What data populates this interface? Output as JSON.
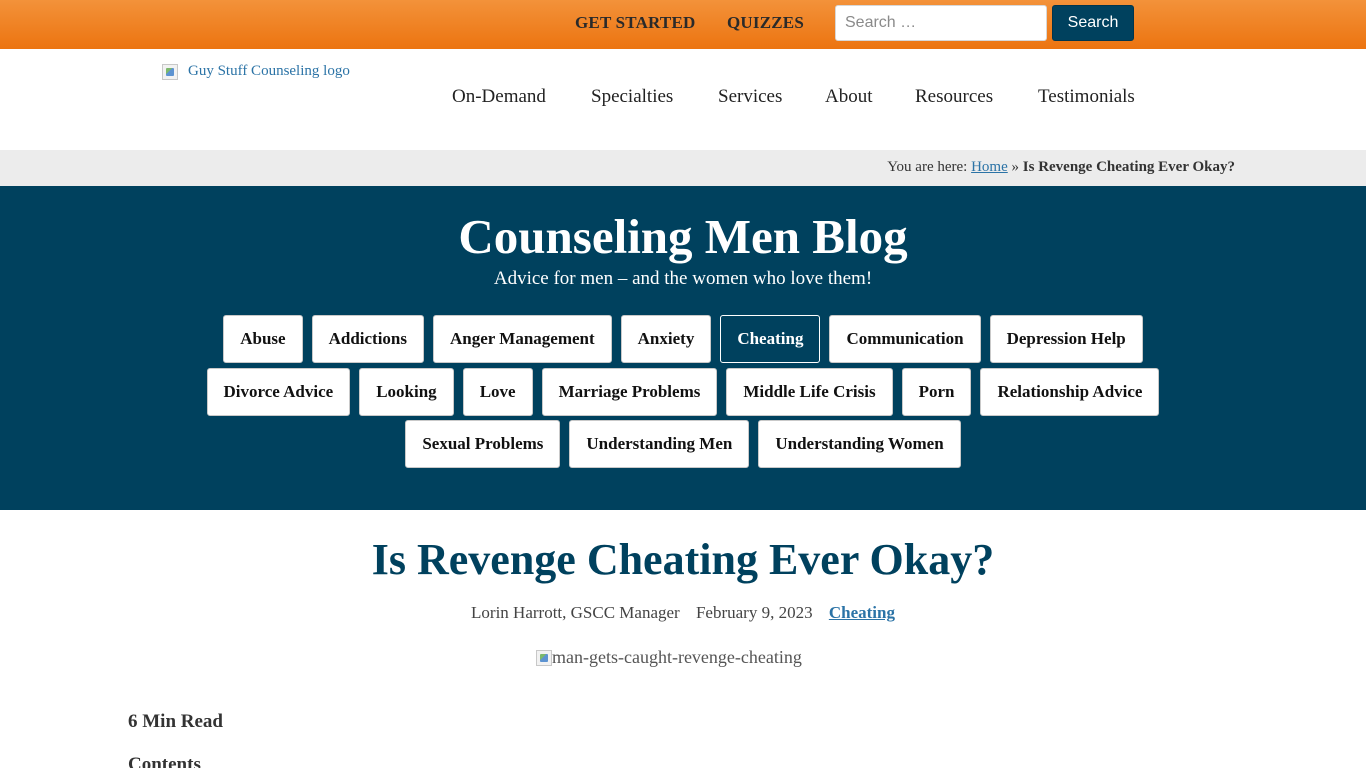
{
  "topbar": {
    "links": [
      "GET STARTED",
      "QUIZZES"
    ],
    "search": {
      "placeholder": "Search …",
      "value": "",
      "button_label": "Search"
    },
    "gradient_colors": [
      "#f3923a",
      "#ec7410"
    ]
  },
  "header": {
    "logo_alt": "Guy Stuff Counseling logo",
    "nav": [
      "On-Demand",
      "Specialties",
      "Services",
      "About",
      "Resources",
      "Testimonials"
    ]
  },
  "breadcrumb": {
    "prefix": "You are here:",
    "home": "Home",
    "separator": "»",
    "current": "Is Revenge Cheating Ever Okay?"
  },
  "banner": {
    "title": "Counseling Men Blog",
    "subtitle": "Advice for men – and the women who love them!",
    "background": "#00415e",
    "categories": [
      [
        "Abuse",
        "Addictions",
        "Anger Management",
        "Anxiety",
        "Cheating",
        "Communication",
        "Depression Help"
      ],
      [
        "Divorce Advice",
        "Looking",
        "Love",
        "Marriage Problems",
        "Middle Life Crisis",
        "Porn",
        "Relationship Advice"
      ],
      [
        "Sexual Problems",
        "Understanding Men",
        "Understanding Women"
      ]
    ],
    "active_category": "Cheating"
  },
  "article": {
    "title": "Is Revenge Cheating Ever Okay?",
    "author": "Lorin Harrott, GSCC Manager",
    "date": "February 9, 2023",
    "category": "Cheating",
    "image_alt": "man-gets-caught-revenge-cheating",
    "read_time": "6 Min Read",
    "contents_heading": "Contents"
  }
}
